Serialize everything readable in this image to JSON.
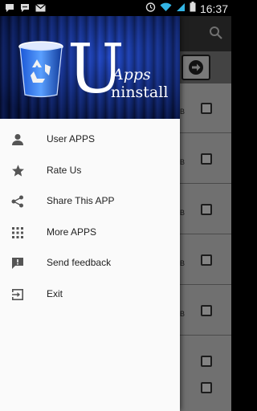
{
  "status_bar": {
    "time": "16:37",
    "left_icons": [
      "chat-bubble-icon",
      "message-icon",
      "gmail-icon"
    ],
    "right_icons": [
      "alarm-icon",
      "wifi-icon",
      "signal-icon",
      "battery-icon"
    ]
  },
  "drawer": {
    "banner": {
      "logo_big_letter": "U",
      "logo_word_top": "Apps",
      "logo_word_bottom": "ninstall",
      "icon": "recycle-bin-icon"
    },
    "menu": [
      {
        "label": "User APPS",
        "icon": "person-icon"
      },
      {
        "label": "Rate Us",
        "icon": "star-icon"
      },
      {
        "label": "Share This APP",
        "icon": "share-icon"
      },
      {
        "label": "More APPS",
        "icon": "grid-icon"
      },
      {
        "label": "Send feedback",
        "icon": "feedback-icon"
      },
      {
        "label": "Exit",
        "icon": "exit-icon"
      }
    ]
  },
  "background": {
    "toolbar_icon": "search-icon",
    "header_icon": "arrow-right-icon",
    "row_size_suffix": "B"
  },
  "colors": {
    "banner_blue": "#1b3bb0",
    "drawer_bg": "#fafafa",
    "icon_gray": "#555555"
  }
}
